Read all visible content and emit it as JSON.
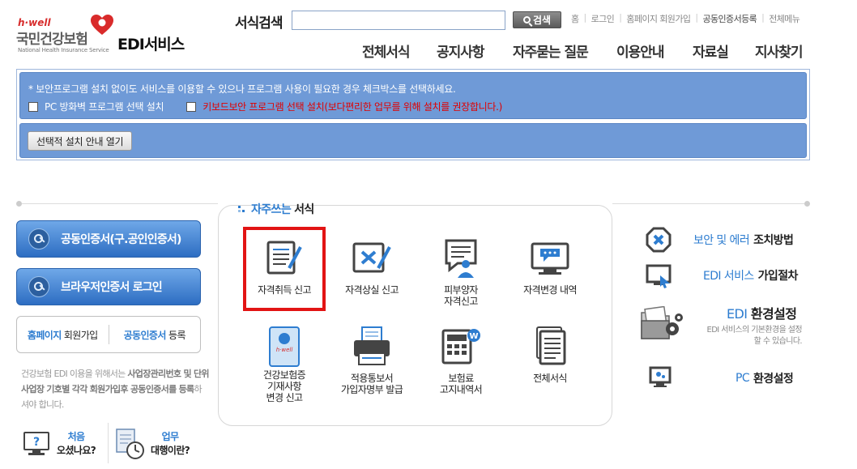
{
  "logo": {
    "hwell": "h·well",
    "korean_name": "국민건강보험",
    "english_name": "National Health Insurance Service",
    "service": "EDI서비스"
  },
  "search": {
    "label": "서식검색",
    "value": "",
    "button": "검색"
  },
  "util_links": [
    "홈",
    "로그인",
    "홈페이지 회원가입",
    "공동인증서등록",
    "전체메뉴"
  ],
  "gnb": [
    "전체서식",
    "공지사항",
    "자주묻는 질문",
    "이용안내",
    "자료실",
    "지사찾기"
  ],
  "security": {
    "notice": "* 보안프로그램 설치 없이도 서비스를 이용할 수 있으나 프로그램 사용이 필요한 경우 체크박스를 선택하세요.",
    "option1": "PC 방화벽 프로그램 선택 설치",
    "option2": "키보드보안 프로그램 선택 설치(보다편리한 업무를 위해 설치를 권장합니다.)",
    "guide_button": "선택적 설치 안내 열기"
  },
  "left": {
    "cert_login": "공동인증서(구.공인인증서)",
    "browser_login": "브라우저인증서 로그인",
    "signup_bold": "홈페이지",
    "signup_rest": " 회원가입",
    "cert_reg_bold": "공동인증서",
    "cert_reg_rest": " 등록",
    "note_1": "건강보험 EDI 이용을 위해서는 ",
    "note_hl1": "사업장관리번호 및 단위 사업장 기호별 각각 회원가입후 공동인증서를 등록",
    "note_2": "하셔야 합니다.",
    "first_visit_1": "처음",
    "first_visit_2": "오셨나요?",
    "agent_1": "업무",
    "agent_2": "대행이란?"
  },
  "favorites": {
    "title_blue": "자주쓰는",
    "title_black": "서식",
    "items": [
      {
        "label": "자격취득 신고",
        "icon": "document-pen-icon"
      },
      {
        "label": "자격상실 신고",
        "icon": "document-x-icon"
      },
      {
        "label": "피부양자\n자격신고",
        "icon": "person-speech-icon"
      },
      {
        "label": "자격변경 내역",
        "icon": "monitor-chat-icon"
      },
      {
        "label": "건강보험증\n기재사항\n변경 신고",
        "icon": "insurance-card-icon"
      },
      {
        "label": "적용통보서\n가입자명부 발급",
        "icon": "printer-icon"
      },
      {
        "label": "보험료\n고지내역서",
        "icon": "calculator-won-icon"
      },
      {
        "label": "전체서식",
        "icon": "document-stack-icon"
      }
    ],
    "highlighted_index": 0
  },
  "right": {
    "security_blue": "보안 및 에러",
    "security_black": "조치방법",
    "join_blue": "EDI 서비스",
    "join_black": "가입절차",
    "env_blue": "EDI",
    "env_black": "환경설정",
    "env_desc": "EDI 서비스의 기본환경을 설정 할 수 있습니다.",
    "pc_blue": "PC",
    "pc_black": "환경설정"
  },
  "colors": {
    "accent_blue": "#2e7dd0",
    "security_bg": "#6f9ad7",
    "warning_red": "#e00000",
    "highlight_red": "#e21414"
  }
}
